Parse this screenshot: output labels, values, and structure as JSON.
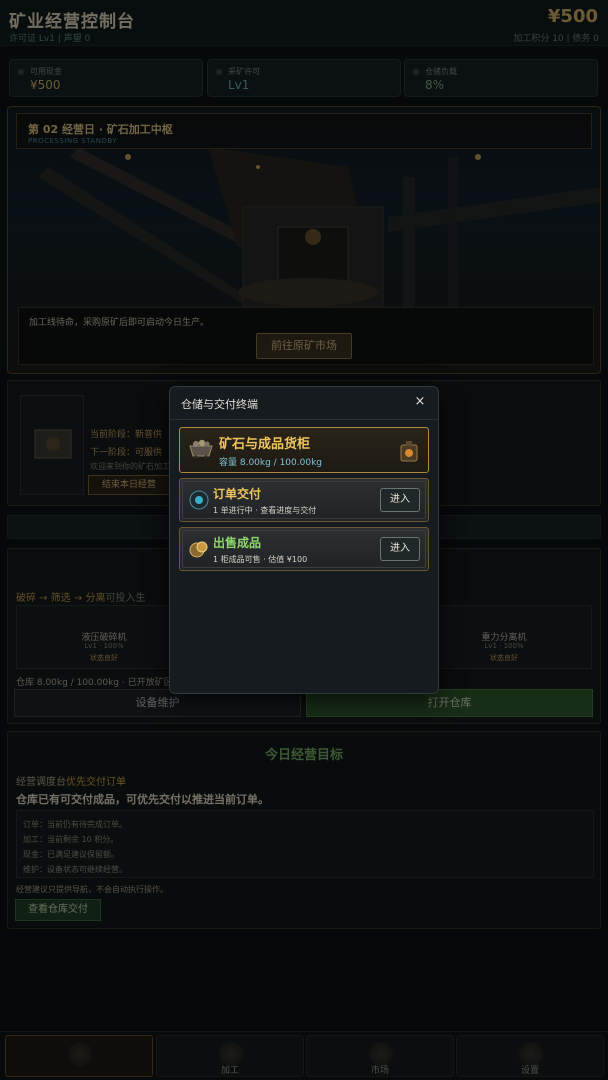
{
  "header": {
    "title": "矿业经营控制台",
    "subtitle": "许可证 Lv1 | 声望 0",
    "money": "¥500",
    "right_sub": "加工积分 10 | 债务 0"
  },
  "stats": [
    {
      "label": "可用现金",
      "value": "¥500",
      "color": "#d7b46a"
    },
    {
      "label": "采矿许可",
      "value": "Lv1",
      "color": "#6fb3b8"
    },
    {
      "label": "仓储负载",
      "value": "8%",
      "color": "#7fb28a"
    }
  ],
  "hero": {
    "day_title": "第 02 经营日 · 矿石加工中枢",
    "day_sub": "PROCESSING STANDBY",
    "message": "加工线待命，采购原矿后即可启动今日生产。",
    "market_button": "前往原矿市场"
  },
  "stage": {
    "current_label": "当前阶段：",
    "current_value": "新普供",
    "next_label": "下一阶段：",
    "next_value": "可服供",
    "welcome": "欢迎来到你的矿石加工",
    "end_day_button": "结束本日经营"
  },
  "flow": {
    "crush": "破碎",
    "screen": "筛选",
    "separate": "分离",
    "suffix": "可投入生",
    "machines": [
      {
        "name": "液压破碎机",
        "meta": "Lv1 · 100%",
        "state": "状态良好"
      },
      {
        "name": "重力分离机",
        "meta": "Lv1 · 100%",
        "state": "状态良好"
      }
    ],
    "stock": "仓库 8.00kg / 100.00kg · 已开放矿区",
    "maintain_button": "设备维护",
    "open_warehouse_button": "打开仓库"
  },
  "goal": {
    "heading": "今日经营目标",
    "source_prefix": "经营调度台",
    "source_highlight": "优先交付订单",
    "main": "仓库已有可交付成品，可优先交付以推进当前订单。",
    "details": [
      "订单：当前仍有待完成订单。",
      "加工：当前剩余 10 积分。",
      "现金：已满足建议保留额。",
      "维护：设备状态可继续经营。"
    ],
    "note": "经营建议只提供导航，不会自动执行操作。",
    "button": "查看仓库交付"
  },
  "nav": [
    {
      "label": ""
    },
    {
      "label": "加工"
    },
    {
      "label": "市场"
    },
    {
      "label": "设置"
    }
  ],
  "modal": {
    "title": "仓储与交付终端",
    "close": "×",
    "cabinet": {
      "title": "矿石与成品货柜",
      "capacity": "容量 8.00kg / 100.00kg"
    },
    "rows": [
      {
        "title": "订单交付",
        "desc": "1 单进行中 · 查看进度与交付",
        "button": "进入",
        "title_color": "#f0c45c",
        "icon": "order-icon"
      },
      {
        "title": "出售成品",
        "desc": "1 柜成品可售 · 估值 ¥100",
        "button": "进入",
        "title_color": "#8fd86a",
        "icon": "gold-icon"
      }
    ]
  }
}
